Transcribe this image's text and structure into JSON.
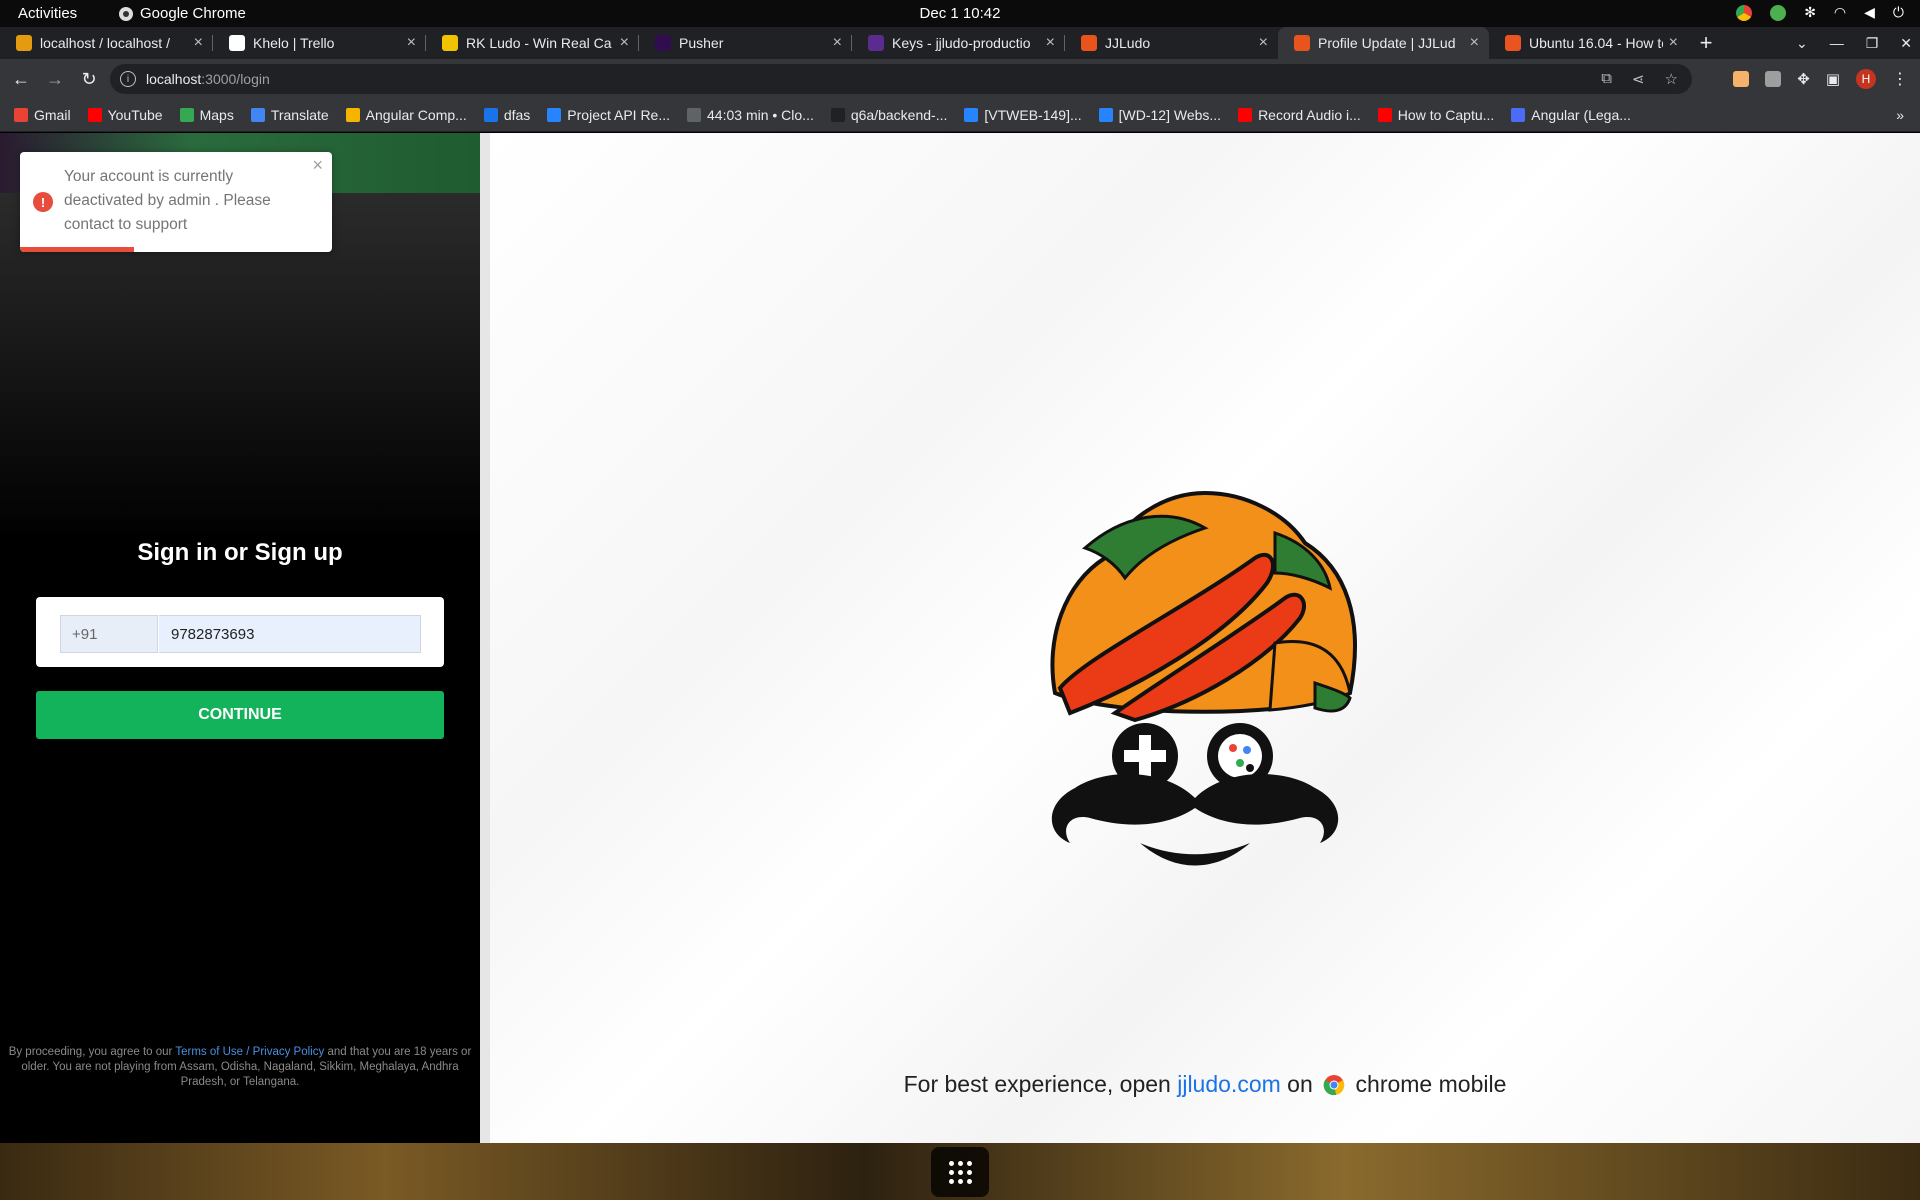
{
  "system": {
    "activities": "Activities",
    "app_name": "Google Chrome",
    "clock": "Dec 1  10:42"
  },
  "tabs": [
    {
      "title": "localhost / localhost /",
      "color": "#e49b0f",
      "active": false
    },
    {
      "title": "Khelo | Trello",
      "color": "#ffffff",
      "active": false
    },
    {
      "title": "RK Ludo - Win Real Ca",
      "color": "#f2c200",
      "active": false
    },
    {
      "title": "Pusher",
      "color": "#300d4f",
      "active": false
    },
    {
      "title": "Keys - jjludo-productio",
      "color": "#5b2c8f",
      "active": false
    },
    {
      "title": "JJLudo",
      "color": "#e8541c",
      "active": false
    },
    {
      "title": "Profile Update | JJLud",
      "color": "#e8541c",
      "active": true
    },
    {
      "title": "Ubuntu 16.04 - How to",
      "color": "#e95420",
      "active": false
    }
  ],
  "omnibox": {
    "host": "localhost",
    "path": ":3000/login"
  },
  "bookmarks": [
    {
      "label": "Gmail",
      "color": "#ea4335"
    },
    {
      "label": "YouTube",
      "color": "#ff0000"
    },
    {
      "label": "Maps",
      "color": "#34a853"
    },
    {
      "label": "Translate",
      "color": "#4285f4"
    },
    {
      "label": "Angular Comp...",
      "color": "#f4b400"
    },
    {
      "label": "dfas",
      "color": "#1a73e8"
    },
    {
      "label": "Project API Re...",
      "color": "#2684ff"
    },
    {
      "label": "44:03 min • Clo...",
      "color": "#5f6368"
    },
    {
      "label": "q6a/backend-...",
      "color": "#202124"
    },
    {
      "label": "[VTWEB-149]...",
      "color": "#2684ff"
    },
    {
      "label": "[WD-12] Webs...",
      "color": "#2684ff"
    },
    {
      "label": "Record Audio i...",
      "color": "#ff0000"
    },
    {
      "label": "How to Captu...",
      "color": "#ff0000"
    },
    {
      "label": "Angular (Lega...",
      "color": "#4a6cf7"
    }
  ],
  "bookmarks_more": "»",
  "toast": {
    "message": "Your account is currently deactivated by admin . Please contact to support",
    "close": "×",
    "icon": "!"
  },
  "login": {
    "title": "Sign in or Sign up",
    "country_code": "+91",
    "phone": "9782873693",
    "continue_label": "CONTINUE",
    "legal_before": "By proceeding, you agree to our ",
    "legal_link": "Terms of Use / Privacy Policy",
    "legal_after": " and that you are 18 years or older. You are not playing from Assam, Odisha, Nagaland, Sikkim, Meghalaya, Andhra Pradesh, or Telangana."
  },
  "promo": {
    "before": "For best experience, open ",
    "site": "jjludo.com",
    "middle": " on ",
    "after": " chrome mobile"
  },
  "colors": {
    "accent_green": "#12b35a",
    "error_red": "#e74c3c",
    "link_blue": "#1a73e8"
  }
}
